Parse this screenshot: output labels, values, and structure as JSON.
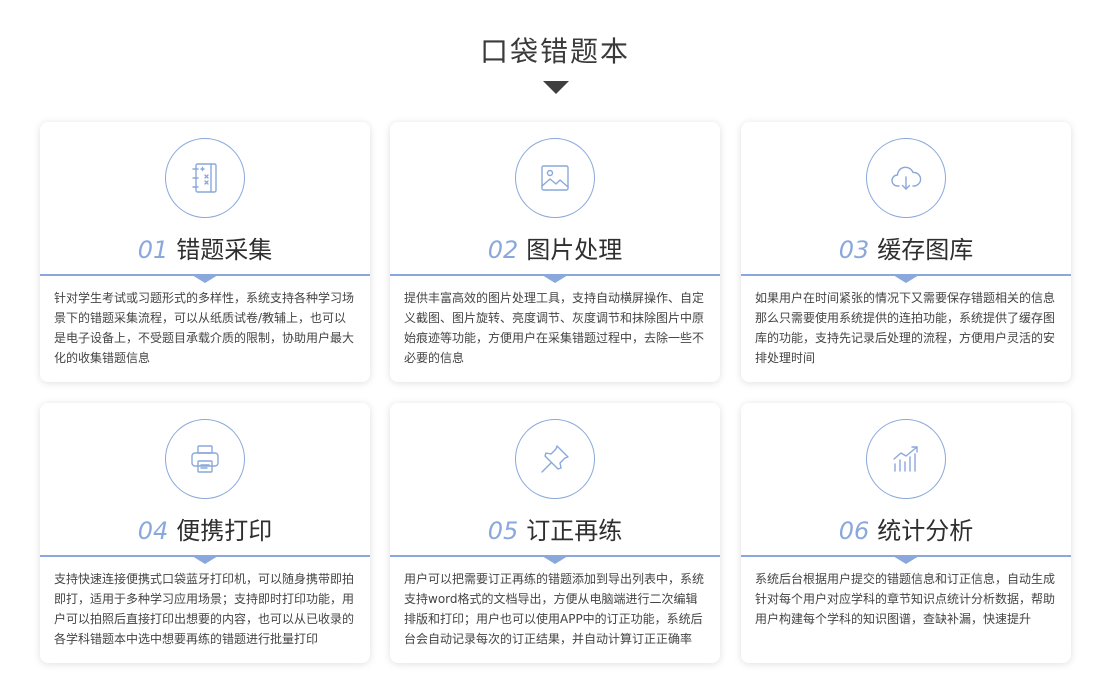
{
  "page": {
    "title": "口袋错题本",
    "accent_color": "#8aa8dc"
  },
  "cards": [
    {
      "num": "01",
      "title": "错题采集",
      "icon": "notebook-icon",
      "desc": "针对学生考试或习题形式的多样性，系统支持各种学习场景下的错题采集流程，可以从纸质试卷/教辅上，也可以是电子设备上，不受题目承载介质的限制，协助用户最大化的收集错题信息"
    },
    {
      "num": "02",
      "title": "图片处理",
      "icon": "image-icon",
      "desc": "提供丰富高效的图片处理工具，支持自动横屏操作、自定义截图、图片旋转、亮度调节、灰度调节和抹除图片中原始痕迹等功能，方便用户在采集错题过程中，去除一些不必要的信息"
    },
    {
      "num": "03",
      "title": "缓存图库",
      "icon": "cloud-download-icon",
      "desc": "如果用户在时间紧张的情况下又需要保存错题相关的信息那么只需要使用系统提供的连拍功能，系统提供了缓存图库的功能，支持先记录后处理的流程，方便用户灵活的安排处理时间"
    },
    {
      "num": "04",
      "title": "便携打印",
      "icon": "printer-icon",
      "desc": "支持快速连接便携式口袋蓝牙打印机，可以随身携带即拍即打，适用于多种学习应用场景；支持即时打印功能，用户可以拍照后直接打印出想要的内容，也可以从已收录的各学科错题本中选中想要再练的错题进行批量打印"
    },
    {
      "num": "05",
      "title": "订正再练",
      "icon": "pushpin-icon",
      "desc": "用户可以把需要订正再练的错题添加到导出列表中，系统支持word格式的文档导出，方便从电脑端进行二次编辑排版和打印；用户也可以使用APP中的订正功能，系统后台会自动记录每次的订正结果，并自动计算订正正确率"
    },
    {
      "num": "06",
      "title": "统计分析",
      "icon": "bar-chart-trend-icon",
      "desc": "系统后台根据用户提交的错题信息和订正信息，自动生成针对每个用户对应学科的章节知识点统计分析数据，帮助用户构建每个学科的知识图谱，查缺补漏，快速提升"
    }
  ]
}
